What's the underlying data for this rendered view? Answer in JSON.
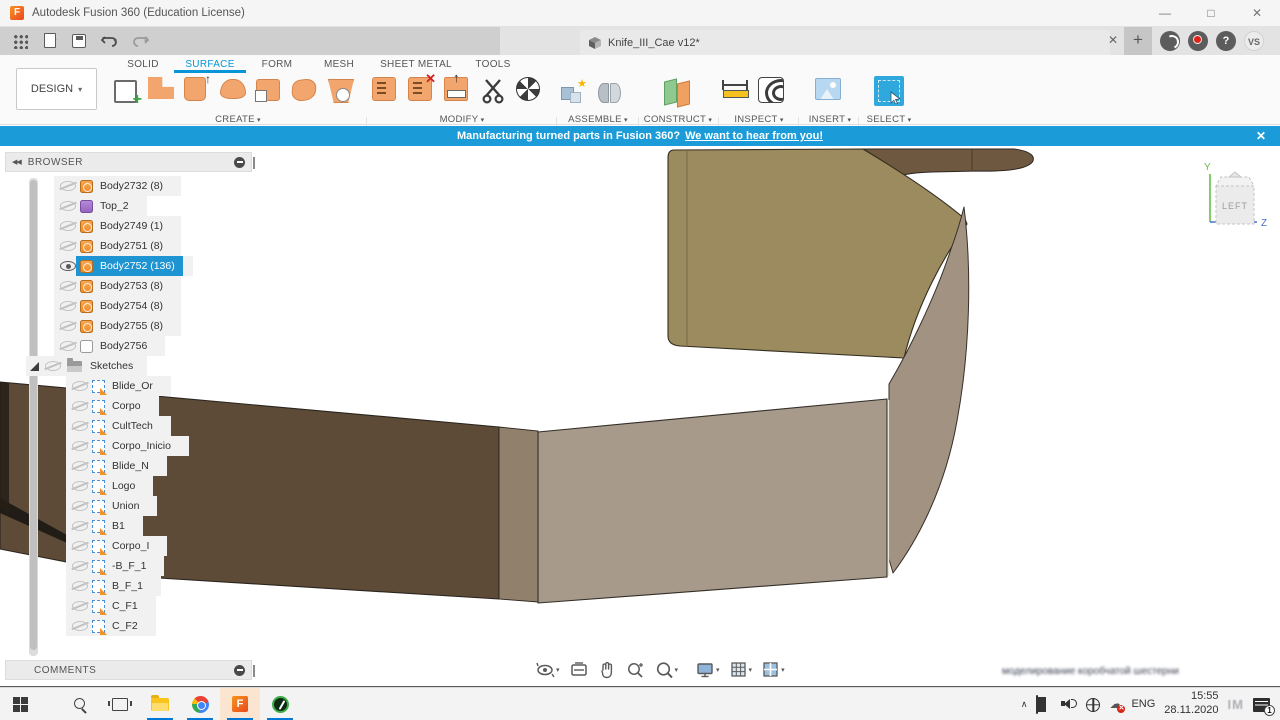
{
  "window": {
    "title": "Autodesk Fusion 360 (Education License)",
    "controls": {
      "minimize": "—",
      "maximize": "□",
      "close": "✕"
    }
  },
  "tabbar": {
    "document_tab": "Knife_III_Cae v12*",
    "close": "✕",
    "new_tab": "+",
    "help": "?",
    "avatar": "VS"
  },
  "ribbon": {
    "design_label": "DESIGN",
    "tabs": [
      {
        "label": "SOLID",
        "active": false
      },
      {
        "label": "SURFACE",
        "active": true
      },
      {
        "label": "FORM",
        "active": false
      },
      {
        "label": "MESH",
        "active": false
      },
      {
        "label": "SHEET METAL",
        "active": false
      },
      {
        "label": "TOOLS",
        "active": false
      }
    ],
    "groups": [
      "CREATE",
      "MODIFY",
      "ASSEMBLE",
      "CONSTRUCT",
      "INSPECT",
      "INSERT",
      "SELECT"
    ]
  },
  "banner": {
    "text": "Manufacturing turned parts in Fusion 360?",
    "link": "We want to hear from you!",
    "close": "✕"
  },
  "browser": {
    "header": "BROWSER",
    "bodies": [
      {
        "label": "Body2732 (8)",
        "icon": "body",
        "visible": false,
        "selected": false
      },
      {
        "label": "Top_2",
        "icon": "component",
        "visible": false,
        "selected": false
      },
      {
        "label": "Body2749 (1)",
        "icon": "body",
        "visible": false,
        "selected": false
      },
      {
        "label": "Body2751 (8)",
        "icon": "body",
        "visible": false,
        "selected": false
      },
      {
        "label": "Body2752 (136)",
        "icon": "body",
        "visible": true,
        "selected": true
      },
      {
        "label": "Body2753 (8)",
        "icon": "body",
        "visible": false,
        "selected": false
      },
      {
        "label": "Body2754 (8)",
        "icon": "body",
        "visible": false,
        "selected": false
      },
      {
        "label": "Body2755 (8)",
        "icon": "body",
        "visible": false,
        "selected": false
      },
      {
        "label": "Body2756",
        "icon": "body-plain",
        "visible": false,
        "selected": false
      }
    ],
    "sketches_label": "Sketches",
    "sketches": [
      "Blide_Or",
      "Corpo",
      "CultTech",
      "Corpo_Inicio",
      "Blide_N",
      "Logo",
      "Union",
      "B1",
      "Corpo_I",
      "-B_F_1",
      "B_F_1",
      "C_F1",
      "C_F2"
    ]
  },
  "comments": {
    "header": "COMMENTS"
  },
  "viewcube": {
    "face": "LEFT",
    "axis_vertical": "Y",
    "axis_horizontal": "Z"
  },
  "watermark": {
    "text": "моделирование коробчатой шестерни",
    "tray": "IM"
  },
  "taskbar": {
    "language": "ENG",
    "time": "15:55",
    "date": "28.11.2020",
    "notification_count": "1"
  },
  "colors": {
    "accent_blue": "#0696d7",
    "banner_blue": "#1b9cd8",
    "selection_blue": "#1f94d2",
    "body_orange": "#f49133",
    "model_khaki": "#9c8b5e",
    "model_dark_brown": "#5d4b38",
    "model_top_brown": "#6f5840",
    "model_tan": "#a79a8b",
    "model_band": "#a29281"
  }
}
